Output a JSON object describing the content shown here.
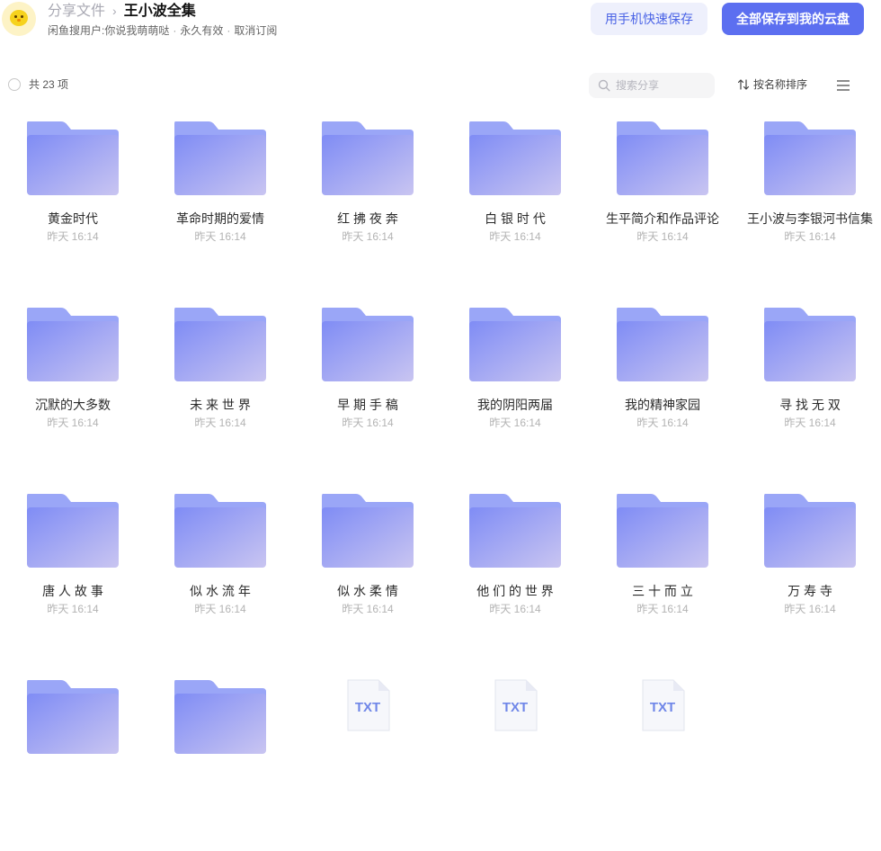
{
  "header": {
    "breadcrumb_root": "分享文件",
    "breadcrumb_sep": "›",
    "breadcrumb_current": "王小波全集",
    "sharer": "闲鱼搜用户:你说我萌萌哒",
    "validity": "永久有效",
    "unsubscribe": "取消订阅",
    "dot": "·",
    "phone_save_button": "用手机快速保存",
    "save_all_button": "全部保存到我的云盘"
  },
  "toolbar": {
    "count_label": "共 23 项",
    "search_placeholder": "搜索分享",
    "sort_label": "按名称排序"
  },
  "colors": {
    "accent": "#5c6ff0",
    "folder_top": "#9aa6f7",
    "folder_front_start": "#7f8cf5",
    "folder_front_end": "#c9c5f1"
  },
  "items": [
    {
      "name": "黄金时代",
      "date": "昨天 16:14",
      "type": "folder"
    },
    {
      "name": "革命时期的爱情",
      "date": "昨天 16:14",
      "type": "folder"
    },
    {
      "name": "红 拂 夜 奔",
      "date": "昨天 16:14",
      "type": "folder"
    },
    {
      "name": "白 银 时 代",
      "date": "昨天 16:14",
      "type": "folder"
    },
    {
      "name": "生平简介和作品评论",
      "date": "昨天 16:14",
      "type": "folder"
    },
    {
      "name": "王小波与李银河书信集",
      "date": "昨天 16:14",
      "type": "folder"
    },
    {
      "name": "沉默的大多数",
      "date": "昨天 16:14",
      "type": "folder"
    },
    {
      "name": "未 来 世 界",
      "date": "昨天 16:14",
      "type": "folder"
    },
    {
      "name": "早 期 手 稿",
      "date": "昨天 16:14",
      "type": "folder"
    },
    {
      "name": "我的阴阳两届",
      "date": "昨天 16:14",
      "type": "folder"
    },
    {
      "name": "我的精神家园",
      "date": "昨天 16:14",
      "type": "folder"
    },
    {
      "name": "寻 找 无 双",
      "date": "昨天 16:14",
      "type": "folder"
    },
    {
      "name": "唐 人 故 事",
      "date": "昨天 16:14",
      "type": "folder"
    },
    {
      "name": "似 水 流 年",
      "date": "昨天 16:14",
      "type": "folder"
    },
    {
      "name": "似 水 柔 情",
      "date": "昨天 16:14",
      "type": "folder"
    },
    {
      "name": "他 们 的 世 界",
      "date": "昨天 16:14",
      "type": "folder"
    },
    {
      "name": "三 十 而 立",
      "date": "昨天 16:14",
      "type": "folder"
    },
    {
      "name": "万 寿 寺",
      "date": "昨天 16:14",
      "type": "folder"
    },
    {
      "name": "",
      "date": "",
      "type": "folder"
    },
    {
      "name": "",
      "date": "",
      "type": "folder"
    },
    {
      "name": "",
      "date": "",
      "type": "txt",
      "badge": "TXT"
    },
    {
      "name": "",
      "date": "",
      "type": "txt",
      "badge": "TXT"
    },
    {
      "name": "",
      "date": "",
      "type": "txt",
      "badge": "TXT"
    }
  ]
}
